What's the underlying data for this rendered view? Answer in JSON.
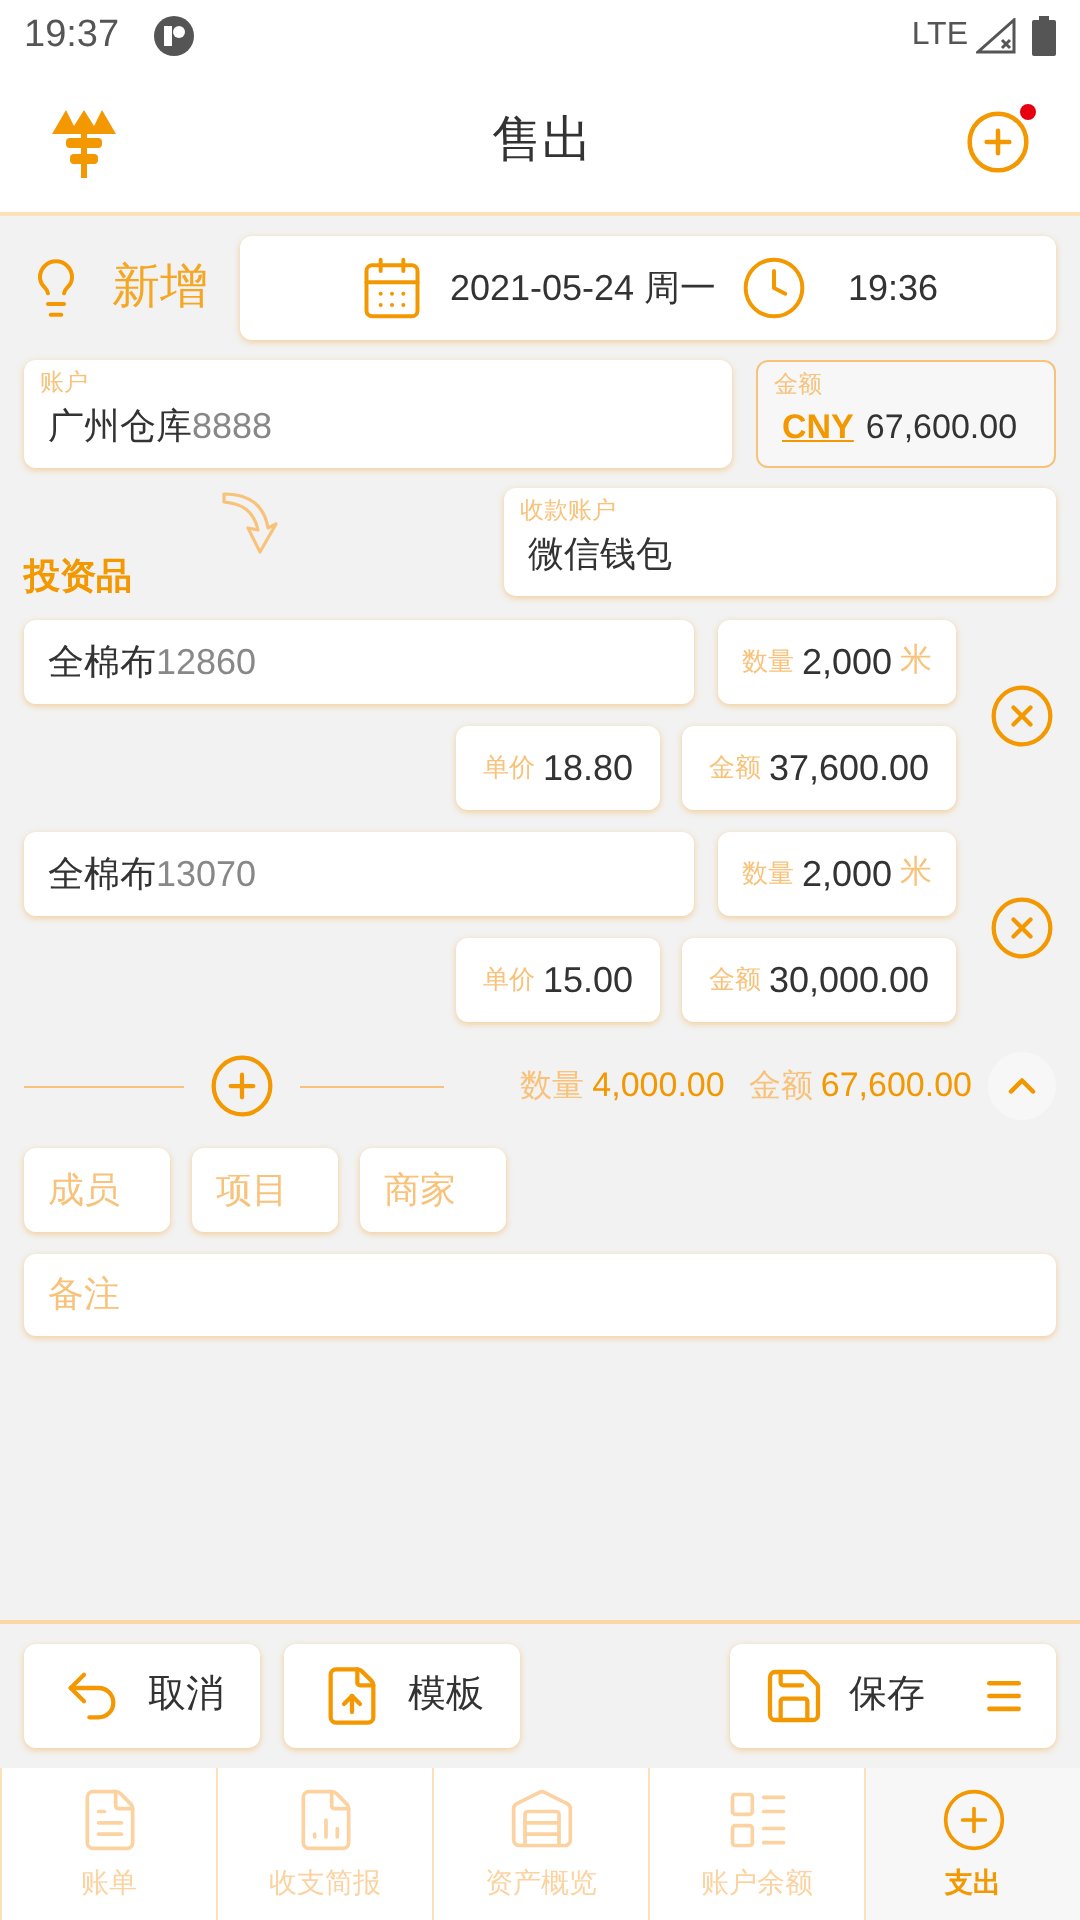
{
  "status_bar": {
    "time": "19:37",
    "network": "LTE"
  },
  "header": {
    "title": "售出",
    "has_notification": true
  },
  "mode": {
    "label": "新增"
  },
  "datetime": {
    "date": "2021-05-24 周一",
    "time": "19:36"
  },
  "account": {
    "label": "账户",
    "name": "广州仓库",
    "code": "8888"
  },
  "amount": {
    "label": "金额",
    "currency": "CNY",
    "value": "67,600.00"
  },
  "receiving_account": {
    "label": "收款账户",
    "value": "微信钱包"
  },
  "section_title": "投资品",
  "items": [
    {
      "name": "全棉布",
      "code": "12860",
      "qty_label": "数量",
      "qty": "2,000",
      "unit": "米",
      "price_label": "单价",
      "price": "18.80",
      "amount_label": "金额",
      "amount": "37,600.00"
    },
    {
      "name": "全棉布",
      "code": "13070",
      "qty_label": "数量",
      "qty": "2,000",
      "unit": "米",
      "price_label": "单价",
      "price": "15.00",
      "amount_label": "金额",
      "amount": "30,000.00"
    }
  ],
  "summary": {
    "qty_label": "数量",
    "qty": "4,000.00",
    "amount_label": "金额",
    "amount": "67,600.00",
    "expanded": true
  },
  "tags": [
    {
      "placeholder": "成员"
    },
    {
      "placeholder": "项目"
    },
    {
      "placeholder": "商家"
    }
  ],
  "note": {
    "placeholder": "备注"
  },
  "actions": [
    {
      "label": "取消",
      "kind": "cancel"
    },
    {
      "label": "模板",
      "kind": "template"
    },
    {
      "label": "保存",
      "kind": "save"
    }
  ],
  "tabs": [
    {
      "label": "账单",
      "kind": "bill",
      "selected": false
    },
    {
      "label": "收支简报",
      "kind": "report",
      "selected": false
    },
    {
      "label": "资产概览",
      "kind": "overview",
      "selected": false
    },
    {
      "label": "账户余额",
      "kind": "balance",
      "selected": false
    },
    {
      "label": "支出",
      "kind": "add",
      "selected": true
    }
  ]
}
